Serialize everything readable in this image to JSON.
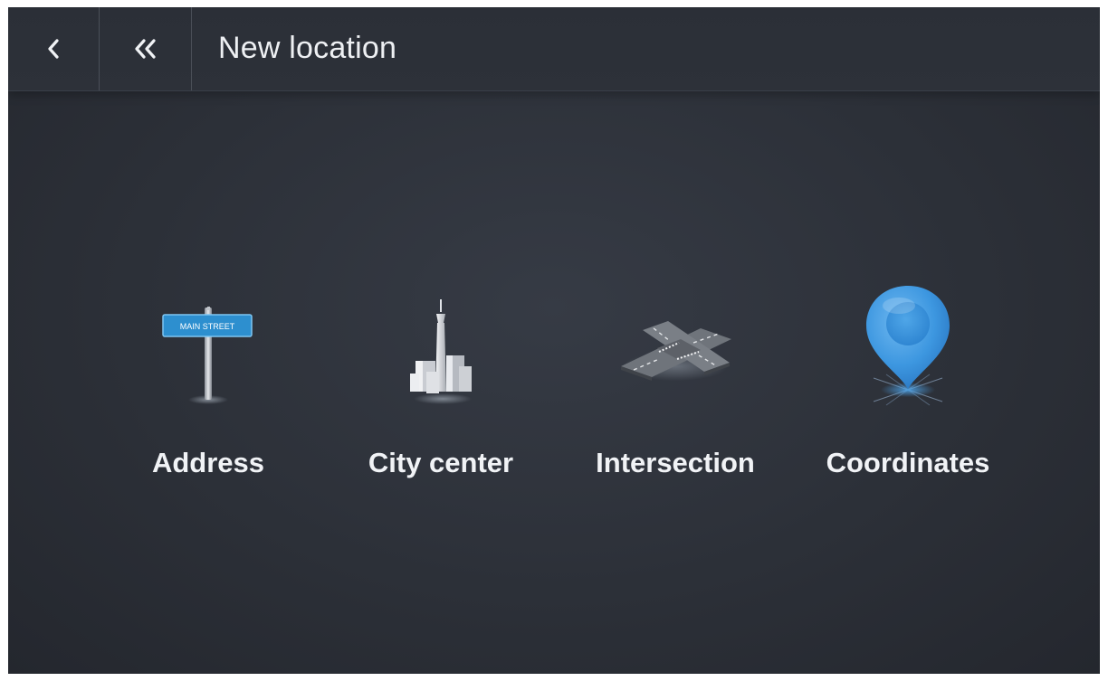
{
  "header": {
    "title": "New location",
    "back_icon": "chevron-left-icon",
    "home_icon": "double-chevron-left-icon"
  },
  "options": [
    {
      "id": "address",
      "label": "Address",
      "icon": "street-sign-icon",
      "sign_text": "MAIN STREET"
    },
    {
      "id": "city-center",
      "label": "City center",
      "icon": "city-tower-icon"
    },
    {
      "id": "intersection",
      "label": "Intersection",
      "icon": "road-crossing-icon"
    },
    {
      "id": "coordinates",
      "label": "Coordinates",
      "icon": "map-pin-icon"
    }
  ],
  "colors": {
    "background": "#2c3038",
    "text": "#f1f3f6",
    "accent_blue": "#3d97e0",
    "sign_blue": "#2d8fcf"
  }
}
